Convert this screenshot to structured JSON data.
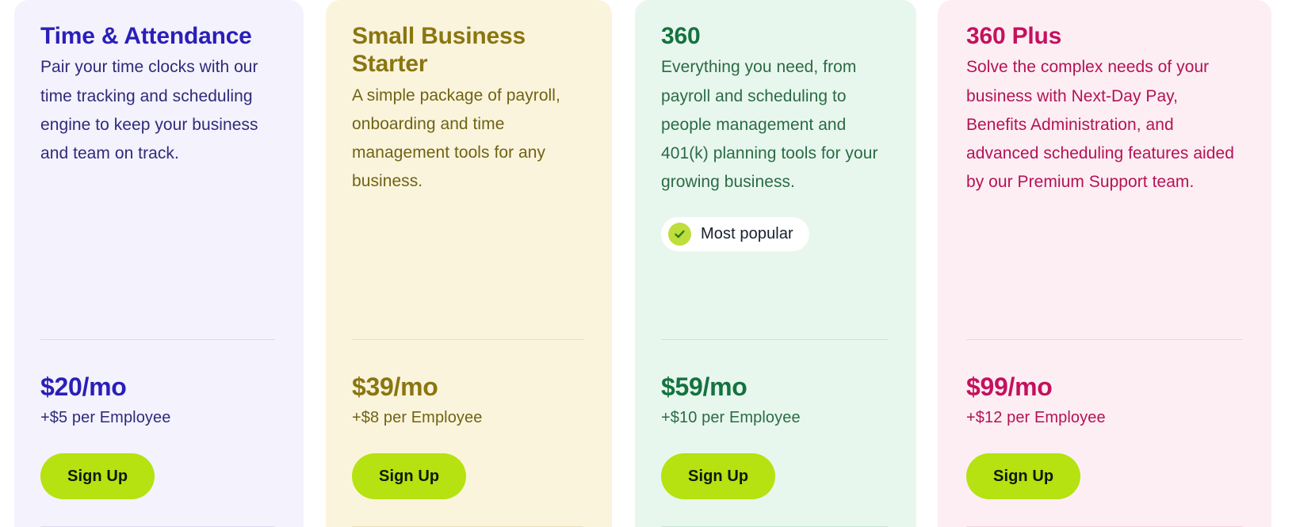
{
  "plans": [
    {
      "name": "Time & Attendance",
      "description": "Pair your time clocks with our time tracking and scheduling engine to keep your business and team on track.",
      "badge": null,
      "price": "$20/mo",
      "per_employee": "+$5 per Employee",
      "cta_label": "Sign Up",
      "accent_color": "#2a1fb8",
      "background_color": "#f4f2fd"
    },
    {
      "name": "Small Business Starter",
      "description": "A simple package of payroll, onboarding and time management tools for any business.",
      "badge": null,
      "price": "$39/mo",
      "per_employee": "+$8 per Employee",
      "cta_label": "Sign Up",
      "accent_color": "#8a7611",
      "background_color": "#fbf4dd"
    },
    {
      "name": "360",
      "description": "Everything you need, from payroll and scheduling to people management and 401(k) planning tools for your growing business.",
      "badge": "Most popular",
      "price": "$59/mo",
      "per_employee": "+$10 per Employee",
      "cta_label": "Sign Up",
      "accent_color": "#14733f",
      "background_color": "#e8f7ee"
    },
    {
      "name": "360 Plus",
      "description": "Solve the complex needs of your business with Next-Day Pay, Benefits Administration, and advanced scheduling features aided by our Premium Support team.",
      "badge": null,
      "price": "$99/mo",
      "per_employee": "+$12 per Employee",
      "cta_label": "Sign Up",
      "accent_color": "#c4115e",
      "background_color": "#fdeef3"
    }
  ],
  "icons": {
    "badge_check": "check-icon"
  },
  "colors": {
    "cta_background": "#b5e210",
    "cta_text": "#10180a",
    "badge_background": "#ffffff",
    "badge_check_circle": "#bede3c",
    "badge_check_mark": "#2f7a1f",
    "badge_text": "#17202e"
  }
}
